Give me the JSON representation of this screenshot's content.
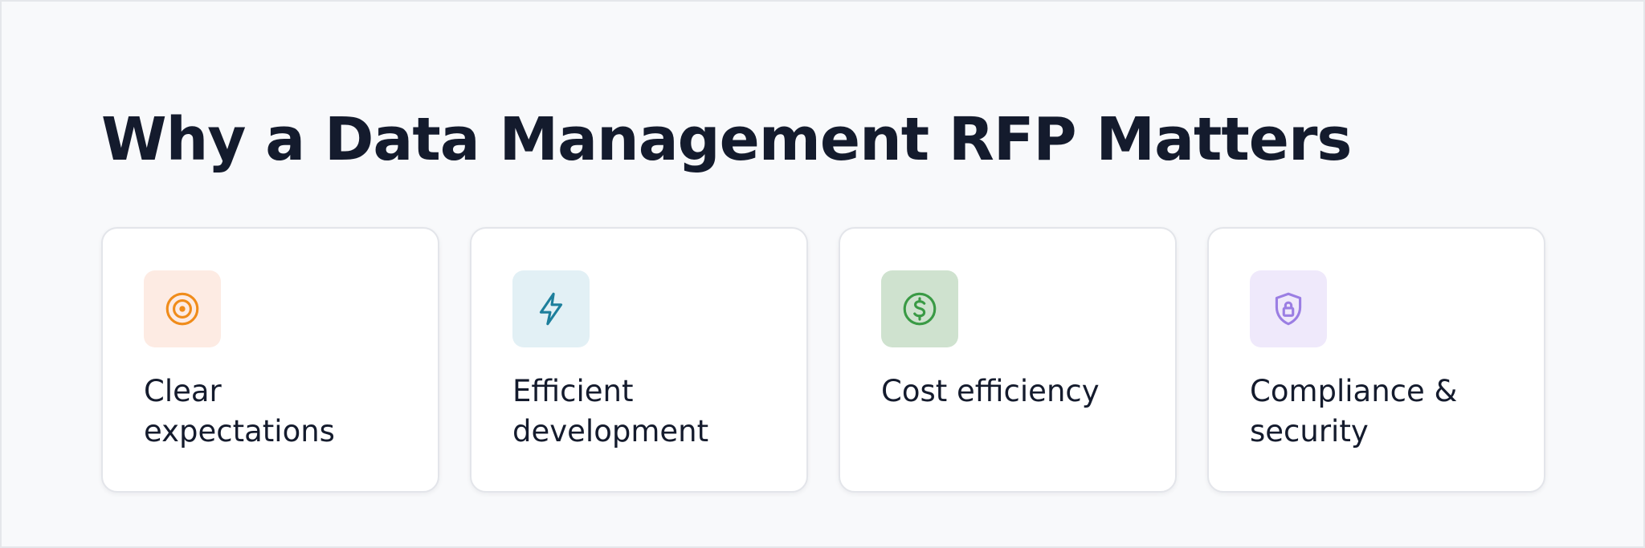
{
  "page": {
    "title": "Why a Data Management RFP Matters"
  },
  "cards": [
    {
      "label": "Clear expectations",
      "icon": "target-icon",
      "icon_color": "#f08c1a",
      "icon_bg": "#fdebe3"
    },
    {
      "label": "Efficient development",
      "icon": "lightning-icon",
      "icon_color": "#1d7f9c",
      "icon_bg": "#e2f0f5"
    },
    {
      "label": "Cost efficiency",
      "icon": "dollar-coin-icon",
      "icon_color": "#3a9a45",
      "icon_bg": "#cfe2cf"
    },
    {
      "label": "Compliance & security",
      "icon": "shield-lock-icon",
      "icon_color": "#9b7ee3",
      "icon_bg": "#efe9fb"
    }
  ]
}
